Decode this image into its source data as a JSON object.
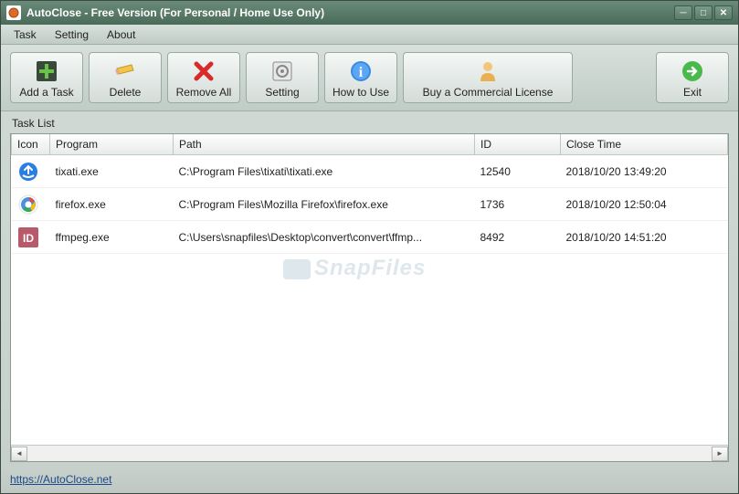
{
  "title": "AutoClose - Free Version (For Personal / Home Use Only)",
  "menubar": {
    "task": "Task",
    "setting": "Setting",
    "about": "About"
  },
  "toolbar": {
    "add_task": "Add a Task",
    "delete": "Delete",
    "remove_all": "Remove All",
    "setting": "Setting",
    "how_to_use": "How to Use",
    "buy_license": "Buy a Commercial License",
    "exit": "Exit"
  },
  "tasklist_label": "Task List",
  "columns": {
    "icon": "Icon",
    "program": "Program",
    "path": "Path",
    "id": "ID",
    "closetime": "Close Time"
  },
  "rows": [
    {
      "icon": "tixati",
      "program": "tixati.exe",
      "path": "C:\\Program Files\\tixati\\tixati.exe",
      "id": "12540",
      "closetime": "2018/10/20 13:49:20"
    },
    {
      "icon": "firefox",
      "program": "firefox.exe",
      "path": "C:\\Program Files\\Mozilla Firefox\\firefox.exe",
      "id": "1736",
      "closetime": "2018/10/20 12:50:04"
    },
    {
      "icon": "ffmpeg",
      "program": "ffmpeg.exe",
      "path": "C:\\Users\\snapfiles\\Desktop\\convert\\convert\\ffmp...",
      "id": "8492",
      "closetime": "2018/10/20 14:51:20"
    }
  ],
  "footer_link": "https://AutoClose.net",
  "watermark": "SnapFiles"
}
